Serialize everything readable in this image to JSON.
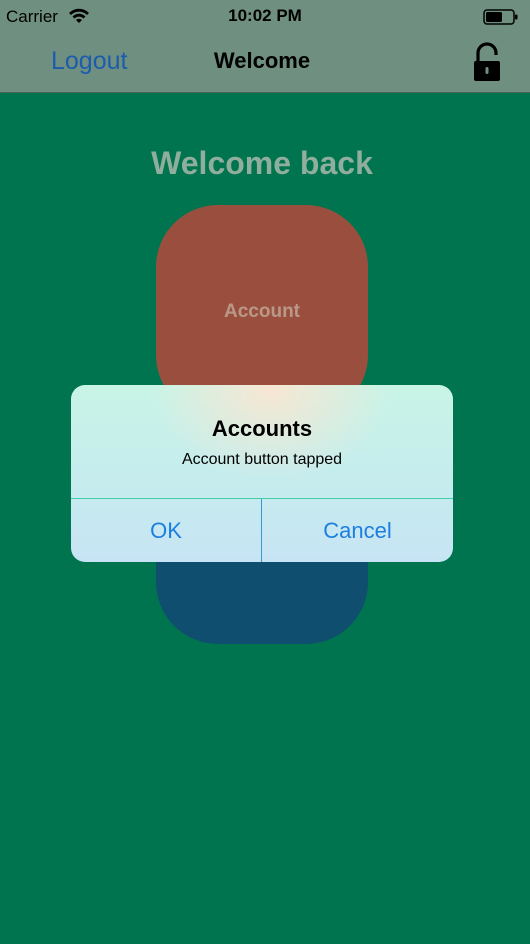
{
  "status_bar": {
    "carrier": "Carrier",
    "time": "10:02 PM",
    "wifi_icon": "wifi-icon",
    "battery_icon": "battery-icon"
  },
  "nav_bar": {
    "left_button": "Logout",
    "title": "Welcome",
    "right_icon": "unlocked-padlock-icon"
  },
  "main": {
    "heading": "Welcome back",
    "account_button_label": "Account"
  },
  "alert": {
    "title": "Accounts",
    "message": "Account button tapped",
    "ok_label": "OK",
    "cancel_label": "Cancel"
  },
  "colors": {
    "background": "#00744f",
    "account_button": "#9a4f3e",
    "second_button": "#0f4e6e",
    "link": "#1c7fe0",
    "nav_bar": "#6f8f80"
  }
}
